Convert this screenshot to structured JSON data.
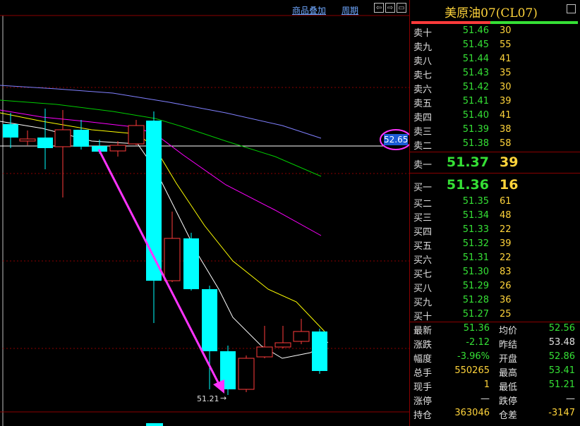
{
  "toolbar": {
    "overlay_label": "商品叠加",
    "period_label": "周期",
    "nav_buttons": [
      "⇦",
      "⇨",
      "▭"
    ]
  },
  "chart": {
    "current_price_tag": "52.65",
    "low_label": "51.21",
    "colors": {
      "down_candle": "#00ffff",
      "up_candle": "#ff3b3b",
      "ma5": "#ffffff",
      "ma10": "#ffff00",
      "ma20": "#ff00ff",
      "ma30": "#00cc00",
      "ma60": "#8080ff",
      "arrow": "#ff33ff",
      "grid": "#8a0000"
    }
  },
  "quote": {
    "title": "美原油07(CL07)",
    "asks": [
      {
        "label": "卖十",
        "price": "51.46",
        "volume": "30"
      },
      {
        "label": "卖九",
        "price": "51.45",
        "volume": "55"
      },
      {
        "label": "卖八",
        "price": "51.44",
        "volume": "41"
      },
      {
        "label": "卖七",
        "price": "51.43",
        "volume": "35"
      },
      {
        "label": "卖六",
        "price": "51.42",
        "volume": "30"
      },
      {
        "label": "卖五",
        "price": "51.41",
        "volume": "39"
      },
      {
        "label": "卖四",
        "price": "51.40",
        "volume": "41"
      },
      {
        "label": "卖三",
        "price": "51.39",
        "volume": "38"
      },
      {
        "label": "卖二",
        "price": "51.38",
        "volume": "58"
      }
    ],
    "best_ask": {
      "label": "卖一",
      "price": "51.37",
      "volume": "39"
    },
    "best_bid": {
      "label": "买一",
      "price": "51.36",
      "volume": "16"
    },
    "bids": [
      {
        "label": "买二",
        "price": "51.35",
        "volume": "61"
      },
      {
        "label": "买三",
        "price": "51.34",
        "volume": "48"
      },
      {
        "label": "买四",
        "price": "51.33",
        "volume": "22"
      },
      {
        "label": "买五",
        "price": "51.32",
        "volume": "39"
      },
      {
        "label": "买六",
        "price": "51.31",
        "volume": "22"
      },
      {
        "label": "买七",
        "price": "51.30",
        "volume": "83"
      },
      {
        "label": "买八",
        "price": "51.29",
        "volume": "26"
      },
      {
        "label": "买九",
        "price": "51.28",
        "volume": "36"
      },
      {
        "label": "买十",
        "price": "51.27",
        "volume": "25"
      }
    ],
    "stats": [
      {
        "k1": "最新",
        "v1": "51.36",
        "c1": "#35e035",
        "k2": "均价",
        "v2": "52.56",
        "c2": "#35e035"
      },
      {
        "k1": "涨跌",
        "v1": "-2.12",
        "c1": "#35e035",
        "k2": "昨结",
        "v2": "53.48",
        "c2": "#e0e0e0"
      },
      {
        "k1": "幅度",
        "v1": "-3.96%",
        "c1": "#35e035",
        "k2": "开盘",
        "v2": "52.86",
        "c2": "#35e035"
      },
      {
        "k1": "总手",
        "v1": "550265",
        "c1": "#ffd43b",
        "k2": "最高",
        "v2": "53.41",
        "c2": "#35e035"
      },
      {
        "k1": "现手",
        "v1": "1",
        "c1": "#ffd43b",
        "k2": "最低",
        "v2": "51.21",
        "c2": "#35e035"
      },
      {
        "k1": "涨停",
        "v1": "—",
        "c1": "#e0e0e0",
        "k2": "跌停",
        "v2": "—",
        "c2": "#e0e0e0"
      },
      {
        "k1": "持仓",
        "v1": "363046",
        "c1": "#ffd43b",
        "k2": "仓差",
        "v2": "-3147",
        "c2": "#ffd43b"
      }
    ]
  }
}
